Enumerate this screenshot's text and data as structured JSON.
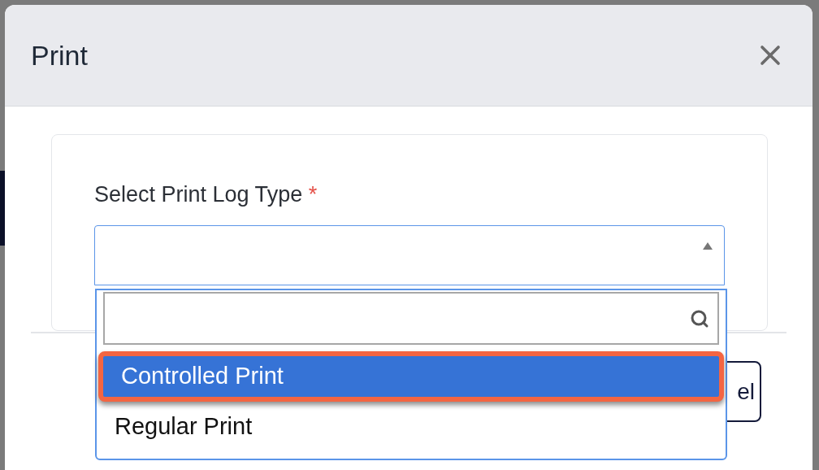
{
  "dialog": {
    "title": "Print",
    "field": {
      "label": "Select Print Log Type",
      "required_mark": "*",
      "expanded": true
    },
    "dropdown": {
      "options": [
        {
          "label": "Controlled Print",
          "selected": true
        },
        {
          "label": "Regular Print",
          "selected": false
        }
      ]
    },
    "footer_button": {
      "label": "el"
    }
  }
}
